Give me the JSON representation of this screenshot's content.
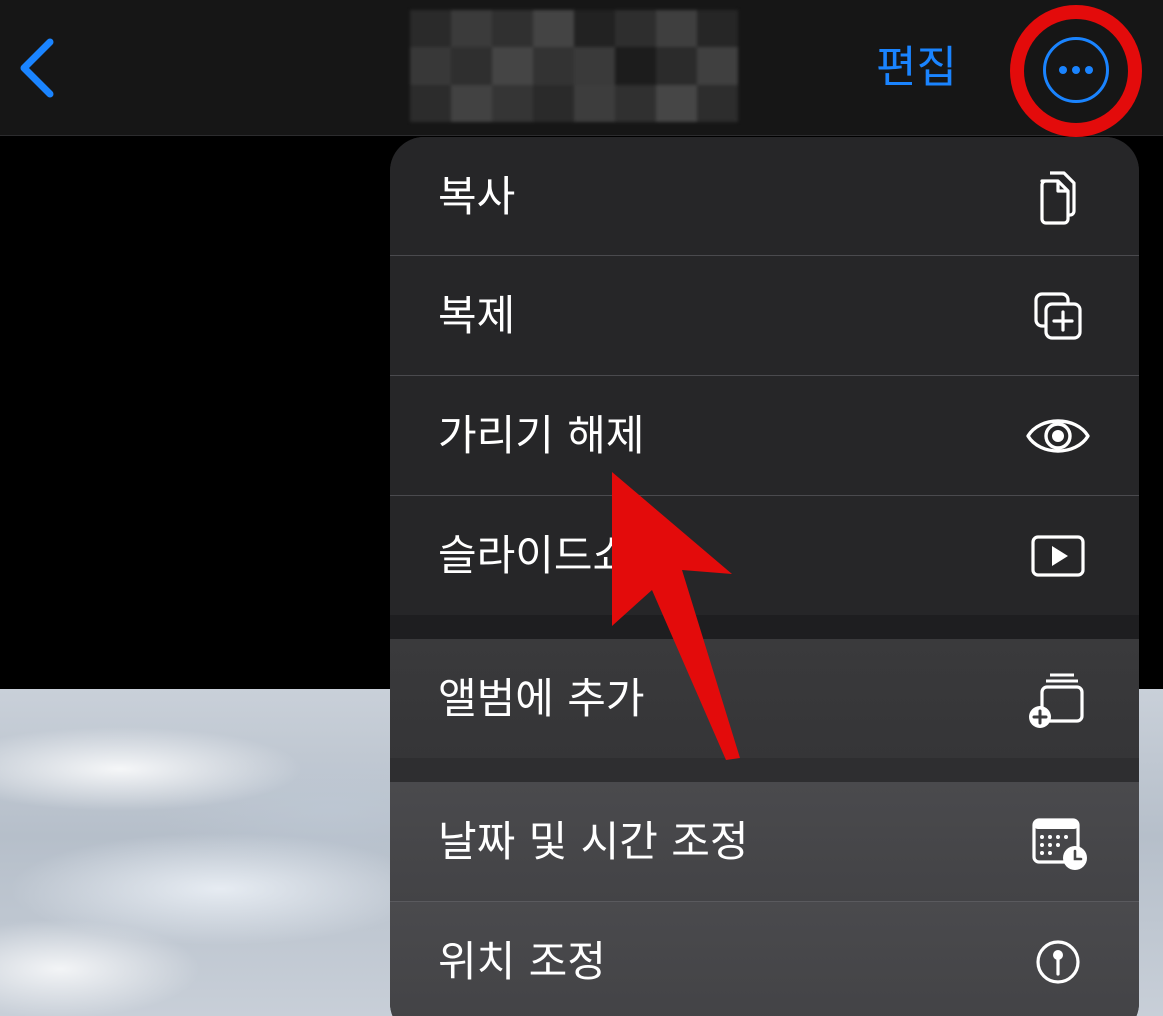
{
  "navbar": {
    "back_icon": "chevron-left-icon",
    "edit_label": "편집",
    "more_icon": "ellipsis-circle-icon",
    "accent_color": "#1a84ff"
  },
  "menu": {
    "items": [
      {
        "label": "복사",
        "icon": "copy-icon"
      },
      {
        "label": "복제",
        "icon": "duplicate-icon"
      },
      {
        "label": "가리기 해제",
        "icon": "eye-icon"
      },
      {
        "label": "슬라이드쇼",
        "icon": "play-rectangle-icon"
      },
      {
        "label": "앨범에 추가",
        "icon": "add-to-album-icon"
      },
      {
        "label": "날짜 및 시간 조정",
        "icon": "calendar-clock-icon"
      },
      {
        "label": "위치 조정",
        "icon": "location-pin-icon"
      }
    ]
  },
  "annotation": {
    "highlight_color": "#e30b0b"
  }
}
